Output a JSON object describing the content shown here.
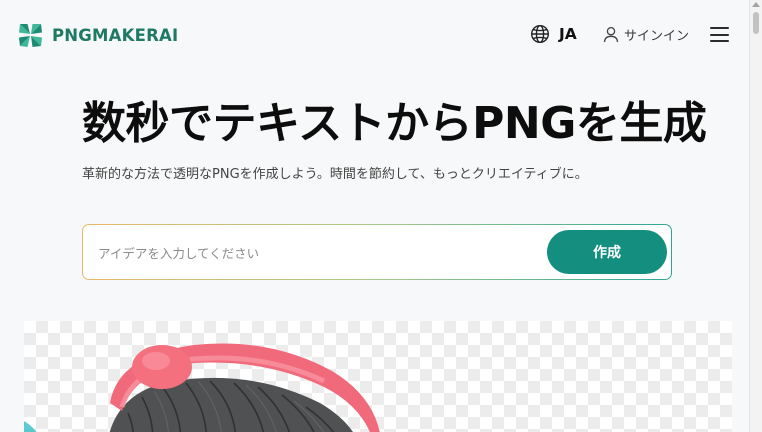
{
  "brand": {
    "name": "PNGMAKERAI",
    "color": "#1e7a62",
    "logo_icon": "clover-logo-icon"
  },
  "header": {
    "language_icon": "globe-icon",
    "language_code": "JA",
    "signin_icon": "user-icon",
    "signin_label": "サインイン",
    "menu_icon": "hamburger-menu-icon"
  },
  "hero": {
    "title": "数秒でテキストからPNGを生成",
    "subtitle": "革新的な方法で透明なPNGを作成しよう。時間を節約して、もっとクリエイティブに。"
  },
  "prompt": {
    "placeholder": "アイデアを入力してください",
    "value": "",
    "submit_label": "作成"
  },
  "colors": {
    "accent": "#138e7f",
    "border_gradient": [
      "#eab86a",
      "#a9c98a",
      "#2fa595"
    ],
    "background": "#f7f8f9"
  }
}
